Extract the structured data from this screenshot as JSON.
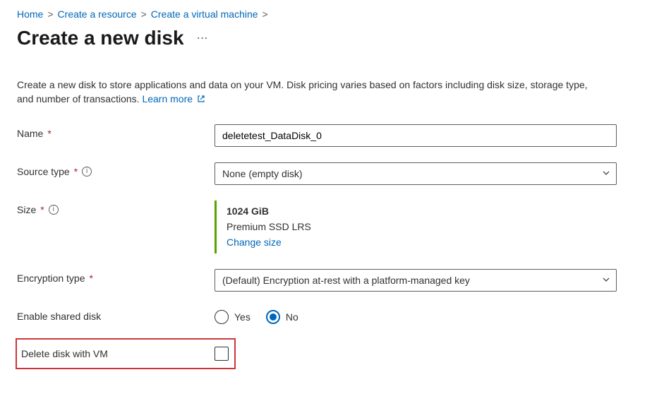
{
  "breadcrumb": {
    "items": [
      {
        "label": "Home"
      },
      {
        "label": "Create a resource"
      },
      {
        "label": "Create a virtual machine"
      }
    ]
  },
  "page": {
    "title": "Create a new disk"
  },
  "description": {
    "text": "Create a new disk to store applications and data on your VM. Disk pricing varies based on factors including disk size, storage type, and number of transactions. ",
    "learn_more": "Learn more"
  },
  "form": {
    "name": {
      "label": "Name",
      "value": "deletetest_DataDisk_0"
    },
    "source_type": {
      "label": "Source type",
      "selected": "None (empty disk)"
    },
    "size": {
      "label": "Size",
      "value": "1024 GiB",
      "tier": "Premium SSD LRS",
      "change": "Change size"
    },
    "encryption": {
      "label": "Encryption type",
      "selected": "(Default) Encryption at-rest with a platform-managed key"
    },
    "shared_disk": {
      "label": "Enable shared disk",
      "yes": "Yes",
      "no": "No",
      "selected": "no"
    },
    "delete_with_vm": {
      "label": "Delete disk with VM",
      "checked": false
    }
  }
}
